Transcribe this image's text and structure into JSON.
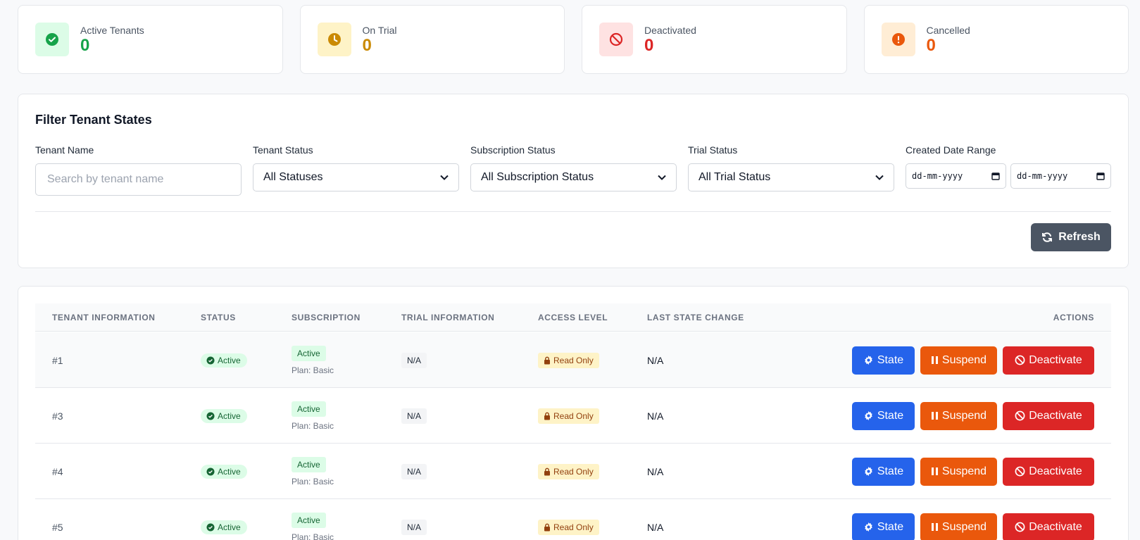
{
  "stats": [
    {
      "label": "Active Tenants",
      "value": "0",
      "icon": "check-circle-icon",
      "color": "#16a34a",
      "bg": "#dcfce7"
    },
    {
      "label": "On Trial",
      "value": "0",
      "icon": "clock-icon",
      "color": "#ca8a04",
      "bg": "#fef3c7"
    },
    {
      "label": "Deactivated",
      "value": "0",
      "icon": "ban-icon",
      "color": "#dc2626",
      "bg": "#fee2e2"
    },
    {
      "label": "Cancelled",
      "value": "0",
      "icon": "exclamation-circle-icon",
      "color": "#ea580c",
      "bg": "#ffedd5"
    }
  ],
  "filters": {
    "title": "Filter Tenant States",
    "tenant_name": {
      "label": "Tenant Name",
      "placeholder": "Search by tenant name"
    },
    "tenant_status": {
      "label": "Tenant Status",
      "value": "All Statuses"
    },
    "subscription_status": {
      "label": "Subscription Status",
      "value": "All Subscription Status"
    },
    "trial_status": {
      "label": "Trial Status",
      "value": "All Trial Status"
    },
    "created_date_range": {
      "label": "Created Date Range",
      "from_placeholder": "dd-mm-yyyy",
      "to_placeholder": "dd-mm-yyyy"
    },
    "refresh_label": "Refresh"
  },
  "table": {
    "columns": [
      "TENANT INFORMATION",
      "STATUS",
      "SUBSCRIPTION",
      "TRIAL INFORMATION",
      "ACCESS LEVEL",
      "LAST STATE CHANGE",
      "ACTIONS"
    ],
    "rows": [
      {
        "id": "#1",
        "status": "Active",
        "subscription": "Active",
        "plan": "Plan: Basic",
        "trial": "N/A",
        "access": "Read Only",
        "last_change": "N/A"
      },
      {
        "id": "#3",
        "status": "Active",
        "subscription": "Active",
        "plan": "Plan: Basic",
        "trial": "N/A",
        "access": "Read Only",
        "last_change": "N/A"
      },
      {
        "id": "#4",
        "status": "Active",
        "subscription": "Active",
        "plan": "Plan: Basic",
        "trial": "N/A",
        "access": "Read Only",
        "last_change": "N/A"
      },
      {
        "id": "#5",
        "status": "Active",
        "subscription": "Active",
        "plan": "Plan: Basic",
        "trial": "N/A",
        "access": "Read Only",
        "last_change": "N/A"
      }
    ],
    "actions": {
      "state": "State",
      "suspend": "Suspend",
      "deactivate": "Deactivate"
    }
  }
}
